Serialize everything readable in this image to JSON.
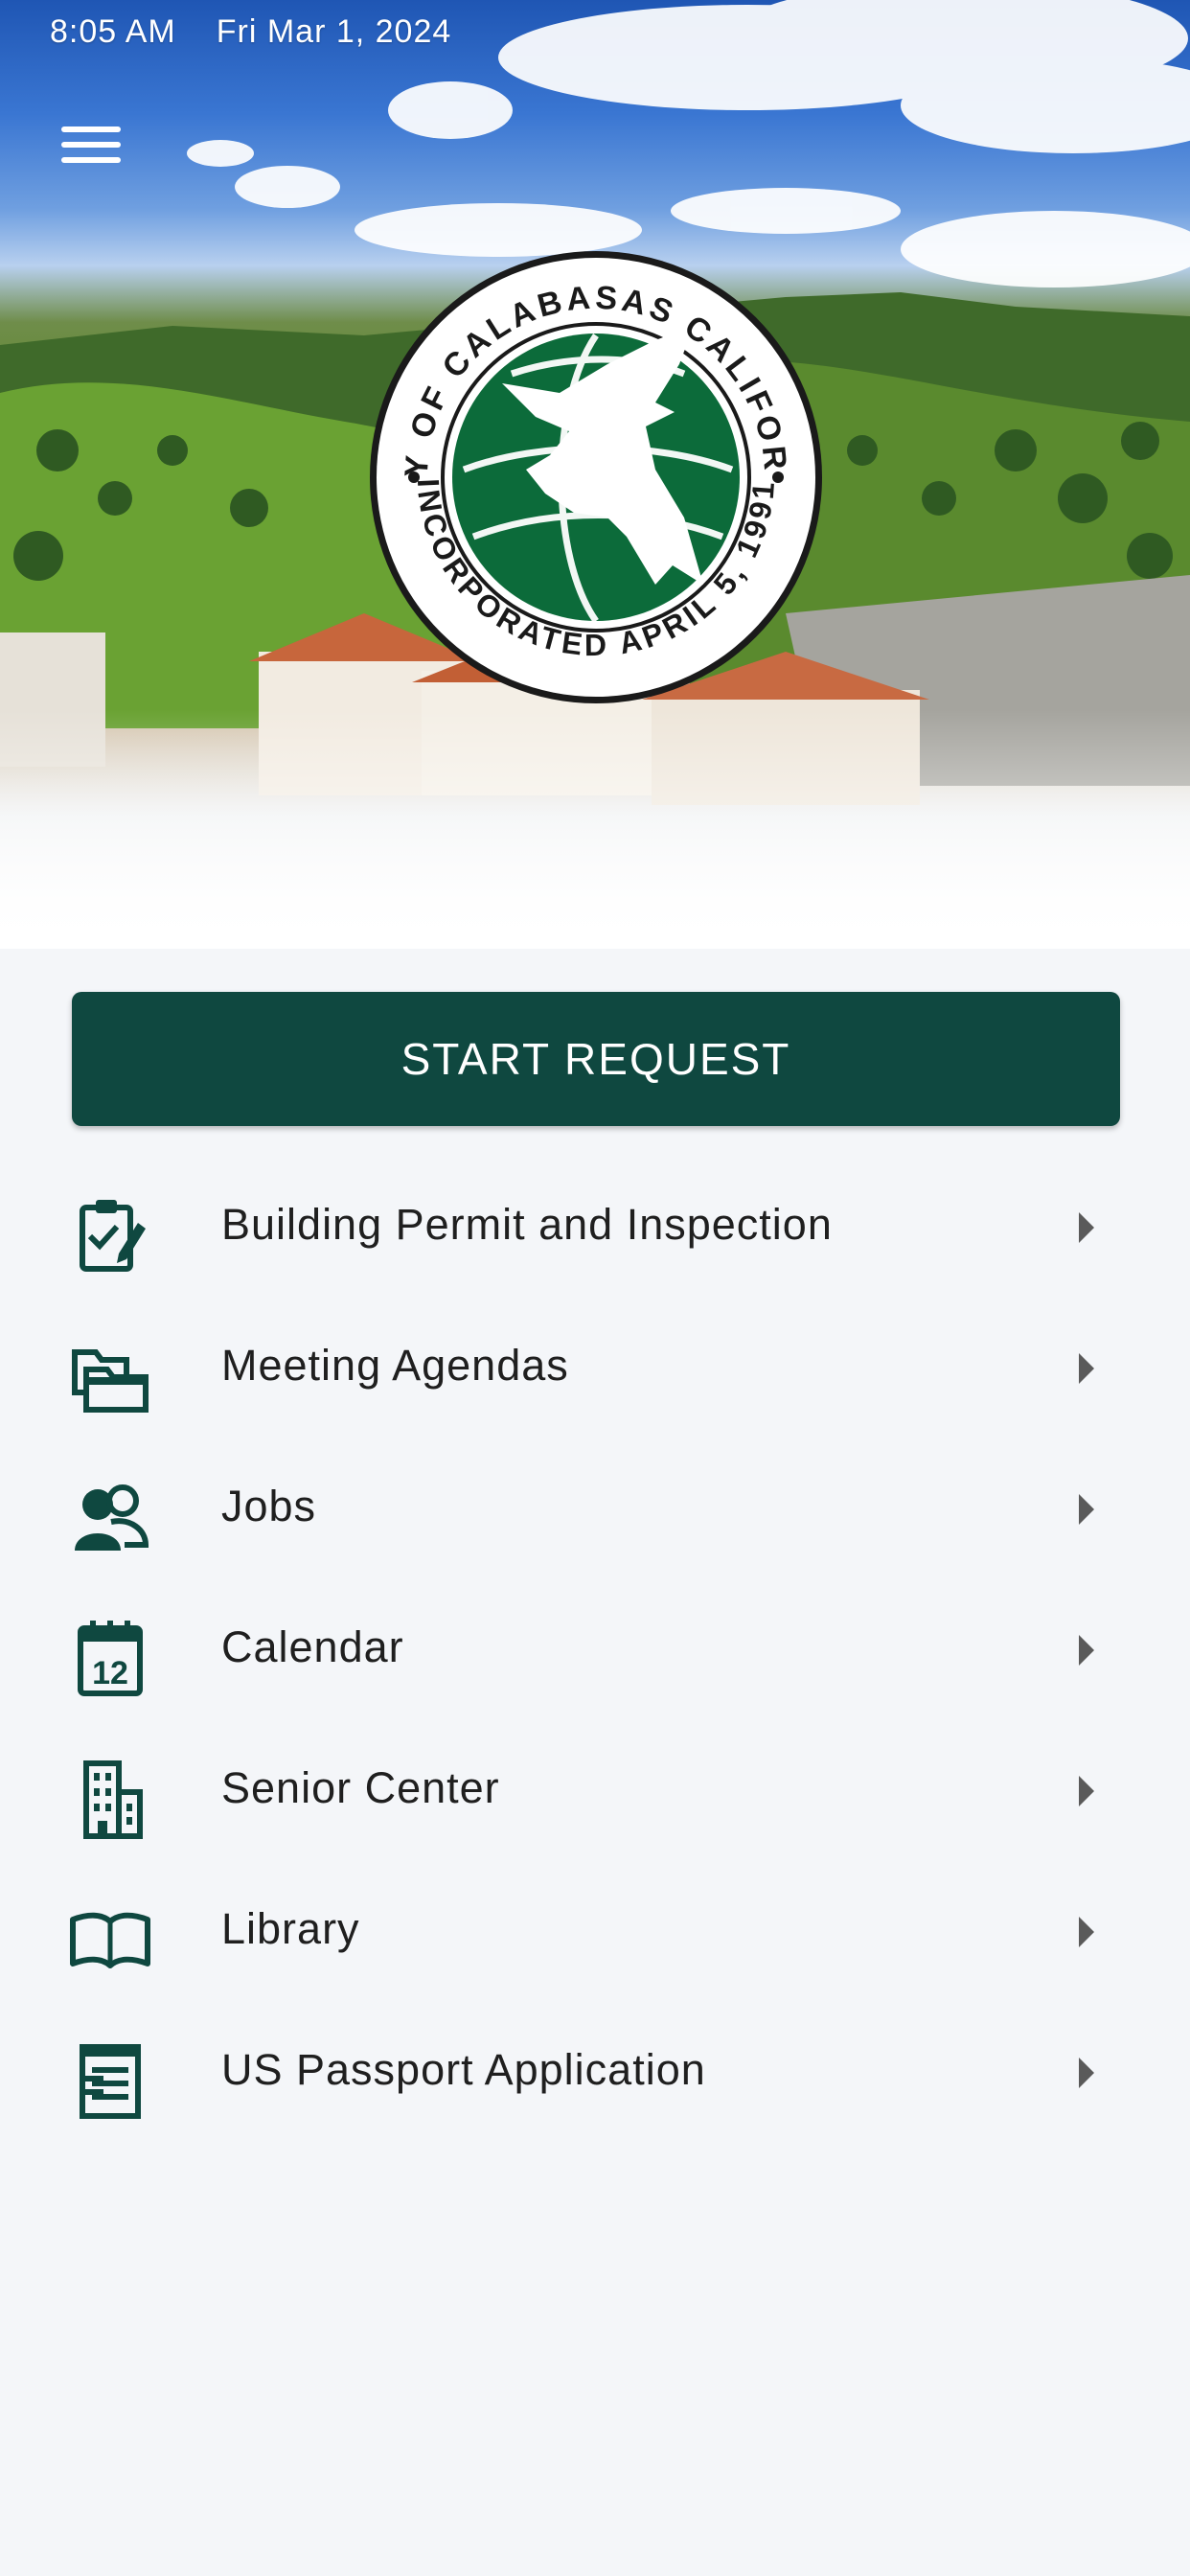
{
  "status_bar": {
    "time": "8:05 AM",
    "date": "Fri Mar 1, 2024"
  },
  "header": {
    "menu_icon": "hamburger-menu-icon",
    "seal": {
      "top_text": "CITY OF CALABASAS CALIFORNIA",
      "bottom_text": "INCORPORATED APRIL 5, 1991"
    }
  },
  "main": {
    "start_request_label": "START REQUEST",
    "items": [
      {
        "label": "Building Permit and Inspection",
        "icon": "clipboard-check-icon"
      },
      {
        "label": "Meeting Agendas",
        "icon": "folders-icon"
      },
      {
        "label": "Jobs",
        "icon": "people-icon"
      },
      {
        "label": "Calendar",
        "icon": "calendar-icon",
        "icon_text": "12"
      },
      {
        "label": "Senior Center",
        "icon": "building-icon"
      },
      {
        "label": "Library",
        "icon": "open-book-icon"
      },
      {
        "label": "US Passport Application",
        "icon": "document-list-icon"
      }
    ]
  },
  "colors": {
    "brand_green": "#0f4840",
    "seal_green": "#0c6b3a",
    "background": "#f4f6f9",
    "text": "#1f1f1f"
  }
}
